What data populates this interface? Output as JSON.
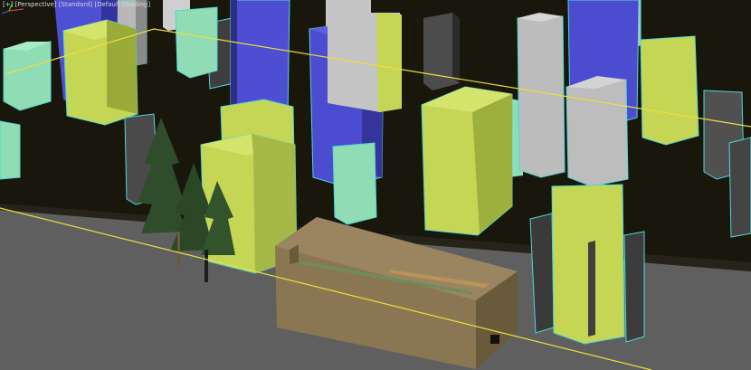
{
  "viewport": {
    "labels": {
      "mode": "[+]",
      "view": "[Perspective]",
      "style": "[Standard]",
      "shading": "[Default Shading]"
    }
  },
  "colors": {
    "background": "#19170c",
    "ground": "#5e5e5e",
    "selection_outline": "#4fd7d7",
    "building_yellow_front": "#c5d655",
    "building_yellow_side": "#8f9d33",
    "building_blue_front": "#4f4fd1",
    "building_blue_side": "#32328f",
    "building_white_front": "#bfbfbf",
    "building_white_side": "#8a8a8a",
    "building_mint_front": "#8fdcb5",
    "building_mint_side": "#5ea586",
    "building_dark_front": "#555555",
    "building_dark_side": "#2f2f2f",
    "bounds_line": "#e8e03c",
    "tree": "#2e4a2c"
  }
}
